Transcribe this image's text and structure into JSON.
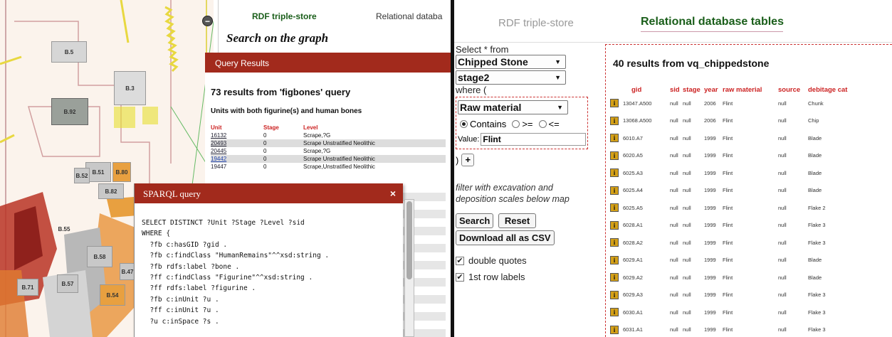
{
  "left_panel": {
    "map": {
      "zoom_label": "−",
      "blocks": [
        {
          "label": "B.5",
          "color": "#d6d6d6"
        },
        {
          "label": "B.3",
          "color": "#dcdcdc"
        },
        {
          "label": "B.92",
          "color": "#9aa09a"
        },
        {
          "label": "B.51",
          "color": "#c8c8c8"
        },
        {
          "label": "B.80",
          "color": "#e8a040"
        },
        {
          "label": "B.52",
          "color": "#c8c8c8"
        },
        {
          "label": "B.82",
          "color": "#c8c8c8"
        },
        {
          "label": "B.55",
          "color": "#b03028"
        },
        {
          "label": "B.58",
          "color": "#c8c8c8"
        },
        {
          "label": "B.47",
          "color": "#c8c8c8"
        },
        {
          "label": "B.71",
          "color": "#c8c8c8"
        },
        {
          "label": "B.57",
          "color": "#c8c8c8"
        },
        {
          "label": "B.54",
          "color": "#e8a040"
        }
      ]
    },
    "tabs": {
      "rdf": "RDF triple-store",
      "relational": "Relational databa"
    },
    "search_heading": "Search on the graph",
    "query_results": {
      "header": "Query Results",
      "count_text": "73 results from 'figbones' query",
      "subtitle": "Units with both figurine(s) and human bones",
      "columns": [
        "Unit",
        "Stage",
        "Level"
      ],
      "rows": [
        {
          "unit": "16132",
          "stage": "0",
          "level": "Scrape,?G"
        },
        {
          "unit": "20493",
          "stage": "0",
          "level": "Scrape Unstratified Neolithic"
        },
        {
          "unit": "20445",
          "stage": "0",
          "level": "Scrape,?G"
        },
        {
          "unit": "19442",
          "stage": "0",
          "level": "Scrape Unstratified Neolithic"
        },
        {
          "unit": "19447",
          "stage": "0",
          "level": "Scrape,Unstratified Neolithic"
        }
      ]
    },
    "sparql": {
      "title": "SPARQL query",
      "close_label": "×",
      "code": "SELECT DISTINCT ?Unit ?Stage ?Level ?sid\nWHERE {\n  ?fb c:hasGID ?gid .\n  ?fb c:findClass \"HumanRemains\"^^xsd:string .\n  ?fb rdfs:label ?bone .\n  ?ff c:findClass \"Figurine\"^^xsd:string .\n  ?ff rdfs:label ?figurine .\n  ?fb c:inUnit ?u .\n  ?ff c:inUnit ?u .\n  ?u c:inSpace ?s ."
    }
  },
  "right_panel": {
    "tabs": {
      "rdf": "RDF triple-store",
      "relational": "Relational database tables"
    },
    "form": {
      "select_label": "Select * from",
      "table_value": "Chipped Stone",
      "stage_value": "stage2",
      "where_label": "where (",
      "field_value": "Raw material",
      "op_contains": "Contains",
      "op_gte": ">=",
      "op_lte": "<=",
      "value_label": "Value:",
      "value_input": "Flint",
      "paren_close": ")",
      "plus_label": "+",
      "filter_note": "filter with excavation and deposition scales below map",
      "search_btn": "Search",
      "reset_btn": "Reset",
      "csv_btn": "Download all as CSV",
      "double_quotes": "double quotes",
      "first_row_labels": "1st row labels"
    },
    "results": {
      "title": "40 results from vq_chippedstone",
      "columns": [
        "gid",
        "sid",
        "stage",
        "year",
        "raw material",
        "source",
        "debitage cat"
      ],
      "rows": [
        {
          "gid": "13047.A500",
          "sid": "null",
          "stage": "null",
          "year": "2006",
          "raw": "Flint",
          "source": "null",
          "cat": "Chunk"
        },
        {
          "gid": "13068.A500",
          "sid": "null",
          "stage": "null",
          "year": "2006",
          "raw": "Flint",
          "source": "null",
          "cat": "Chip"
        },
        {
          "gid": "6010.A7",
          "sid": "null",
          "stage": "null",
          "year": "1999",
          "raw": "Flint",
          "source": "null",
          "cat": "Blade"
        },
        {
          "gid": "6020.A5",
          "sid": "null",
          "stage": "null",
          "year": "1999",
          "raw": "Flint",
          "source": "null",
          "cat": "Blade"
        },
        {
          "gid": "6025.A3",
          "sid": "null",
          "stage": "null",
          "year": "1999",
          "raw": "Flint",
          "source": "null",
          "cat": "Blade"
        },
        {
          "gid": "6025.A4",
          "sid": "null",
          "stage": "null",
          "year": "1999",
          "raw": "Flint",
          "source": "null",
          "cat": "Blade"
        },
        {
          "gid": "6025.A5",
          "sid": "null",
          "stage": "null",
          "year": "1999",
          "raw": "Flint",
          "source": "null",
          "cat": "Flake 2"
        },
        {
          "gid": "6028.A1",
          "sid": "null",
          "stage": "null",
          "year": "1999",
          "raw": "Flint",
          "source": "null",
          "cat": "Flake 3"
        },
        {
          "gid": "6028.A2",
          "sid": "null",
          "stage": "null",
          "year": "1999",
          "raw": "Flint",
          "source": "null",
          "cat": "Flake 3"
        },
        {
          "gid": "6029.A1",
          "sid": "null",
          "stage": "null",
          "year": "1999",
          "raw": "Flint",
          "source": "null",
          "cat": "Blade"
        },
        {
          "gid": "6029.A2",
          "sid": "null",
          "stage": "null",
          "year": "1999",
          "raw": "Flint",
          "source": "null",
          "cat": "Blade"
        },
        {
          "gid": "6029.A3",
          "sid": "null",
          "stage": "null",
          "year": "1999",
          "raw": "Flint",
          "source": "null",
          "cat": "Flake 3"
        },
        {
          "gid": "6030.A1",
          "sid": "null",
          "stage": "null",
          "year": "1999",
          "raw": "Flint",
          "source": "null",
          "cat": "Flake 3"
        },
        {
          "gid": "6031.A1",
          "sid": "null",
          "stage": "null",
          "year": "1999",
          "raw": "Flint",
          "source": "null",
          "cat": "Flake 3"
        }
      ]
    }
  }
}
